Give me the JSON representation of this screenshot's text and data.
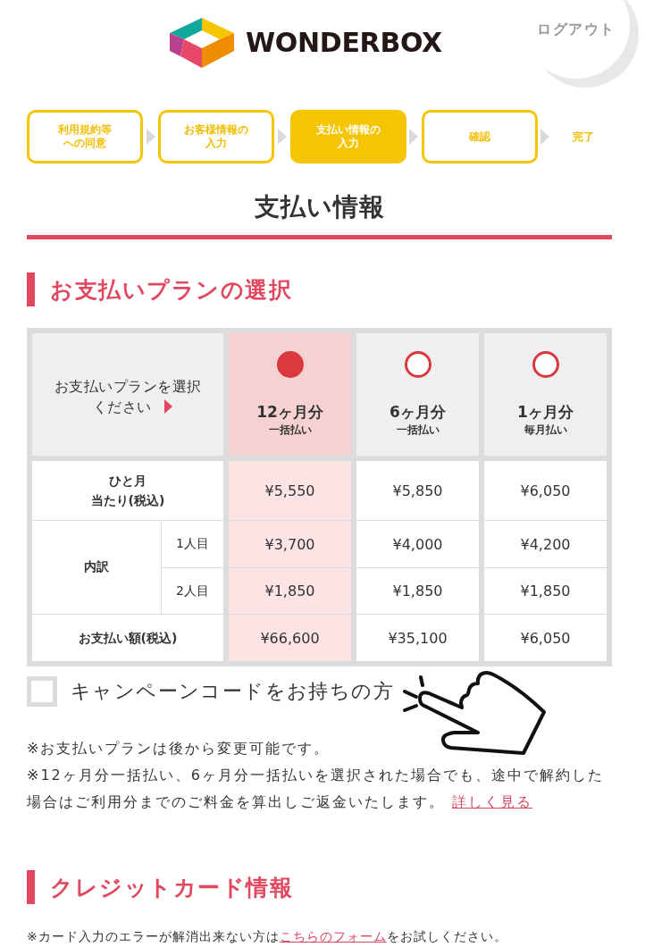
{
  "header": {
    "logo_text": "WONDERBOX",
    "logout": "ログアウト"
  },
  "steps": [
    {
      "lines": [
        "利用規約等",
        "への同意"
      ],
      "kind": "box",
      "current": false
    },
    {
      "lines": [
        "お客様情報の",
        "入力"
      ],
      "kind": "box",
      "current": false
    },
    {
      "lines": [
        "支払い情報の",
        "入力"
      ],
      "kind": "box",
      "current": true
    },
    {
      "lines": [
        "確認"
      ],
      "kind": "box",
      "current": false
    },
    {
      "lines": [
        "完了"
      ],
      "kind": "plain",
      "current": false
    }
  ],
  "title": "支払い情報",
  "plan_section": {
    "heading": "お支払いプランの選択",
    "prompt_lines": [
      "お支払いプランを選択",
      "ください"
    ],
    "plans": [
      {
        "name": "12ヶ月分",
        "billing": "一括払い",
        "selected": true
      },
      {
        "name": "6ヶ月分",
        "billing": "一括払い",
        "selected": false
      },
      {
        "name": "1ヶ月分",
        "billing": "毎月払い",
        "selected": false
      }
    ],
    "rows": [
      {
        "kind": "single",
        "label_lines": [
          "ひと月",
          "当たり(税込)"
        ],
        "values": [
          "¥5,550",
          "¥5,850",
          "¥6,050"
        ]
      },
      {
        "kind": "group",
        "label": "内訳",
        "subrows": [
          {
            "label": "1人目",
            "values": [
              "¥3,700",
              "¥4,000",
              "¥4,200"
            ]
          },
          {
            "label": "2人目",
            "values": [
              "¥1,850",
              "¥1,850",
              "¥1,850"
            ]
          }
        ]
      },
      {
        "kind": "single",
        "label_lines": [
          "お支払い額(税込)"
        ],
        "values": [
          "¥66,600",
          "¥35,100",
          "¥6,050"
        ]
      }
    ],
    "campaign": {
      "label": "キャンペーンコードをお持ちの方",
      "checked": false
    },
    "notes": [
      {
        "text": "※お支払いプランは後から変更可能です。"
      },
      {
        "text": "※12ヶ月分一括払い、6ヶ月分一括払いを選択された場合でも、途中で解約した場合はご利用分までのご料金を算出しご返金いたします。",
        "link": "詳しく見る"
      }
    ]
  },
  "card_section": {
    "heading": "クレジットカード情報",
    "note": {
      "before": "※カード入力のエラーが解消出来ない方は",
      "link": "こちらのフォーム",
      "after": "をお試しください。"
    }
  }
}
